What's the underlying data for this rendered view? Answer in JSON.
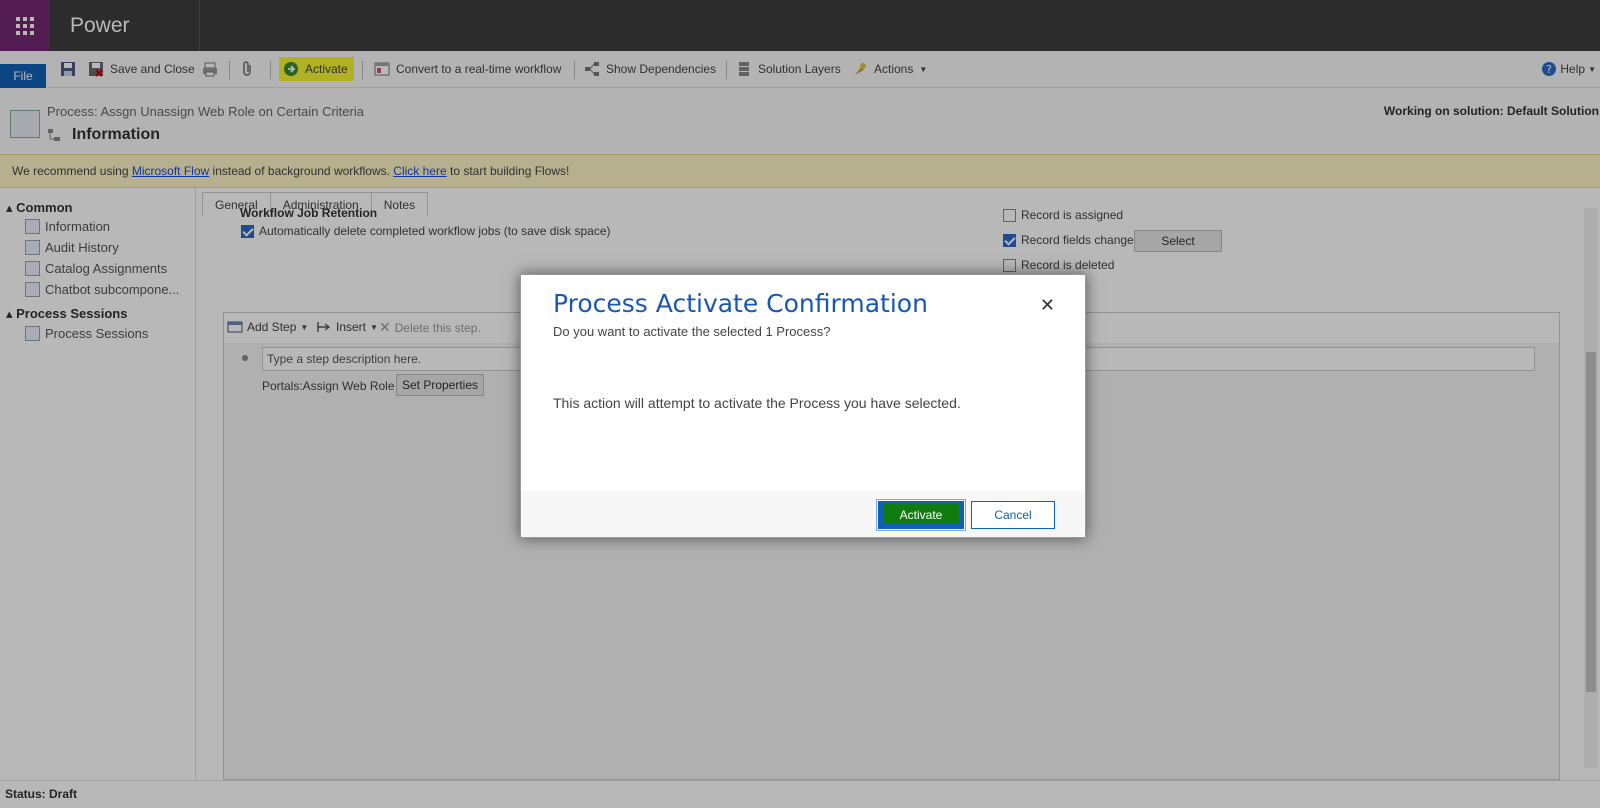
{
  "header": {
    "app_name": "Power Apps"
  },
  "commandbar": {
    "file": "File",
    "save_and_close": "Save and Close",
    "activate": "Activate",
    "convert": "Convert to a real-time workflow",
    "show_dependencies": "Show Dependencies",
    "solution_layers": "Solution Layers",
    "actions": "Actions",
    "help": "Help"
  },
  "titlearea": {
    "process_path": "Process: Assgn Unassign Web Role on Certain Criteria",
    "form_title": "Information",
    "solution": "Working on solution: Default Solution"
  },
  "notification": {
    "prefix": "We recommend using ",
    "link1": "Microsoft Flow",
    "middle": " instead of background workflows. ",
    "link2": "Click here",
    "suffix": " to start building Flows!"
  },
  "sidebar": {
    "groups": [
      {
        "label": "Common",
        "items": [
          "Information",
          "Audit History",
          "Catalog Assignments",
          "Chatbot subcompone..."
        ]
      },
      {
        "label": "Process Sessions",
        "items": [
          "Process Sessions"
        ]
      }
    ]
  },
  "form": {
    "tabs": [
      "General",
      "Administration",
      "Notes"
    ],
    "section_label": "Workflow Job Retention",
    "auto_delete": "Automatically delete completed workflow jobs (to save disk space)",
    "triggers": [
      {
        "label": "Record is assigned",
        "checked": false
      },
      {
        "label": "Record fields change",
        "checked": true
      },
      {
        "label": "Record is deleted",
        "checked": false
      }
    ],
    "select_button": "Select"
  },
  "designer": {
    "add_step": "Add Step",
    "insert": "Insert",
    "delete_step": "Delete this step.",
    "step_placeholder": "Type a step description here.",
    "step_label": "Portals:Assign Web Role",
    "set_properties": "Set Properties"
  },
  "status": {
    "text": "Status: Draft"
  },
  "dialog": {
    "title": "Process Activate Confirmation",
    "subtitle": "Do you want to activate the selected 1 Process?",
    "body": "This action will attempt to activate the Process you have selected.",
    "activate": "Activate",
    "cancel": "Cancel",
    "close": "✕"
  },
  "colors": {
    "header_bg": "#3d3d3d",
    "waffle_bg": "#742774",
    "accent": "#1160b7",
    "dialog_title": "#1a56b4",
    "highlight": "#f5f531",
    "notification_bg": "#fef4c6"
  }
}
